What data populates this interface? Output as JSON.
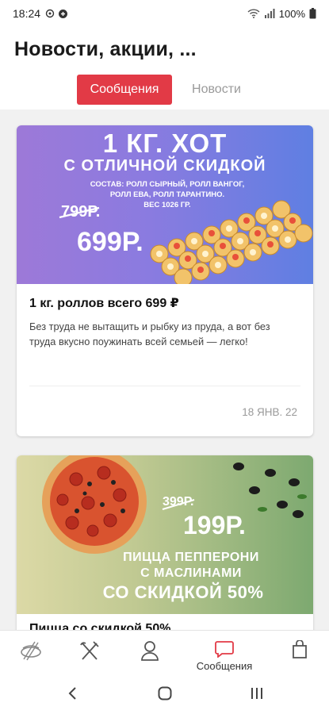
{
  "status_bar": {
    "time": "18:24",
    "battery": "100%"
  },
  "header": {
    "title": "Новости, акции, ..."
  },
  "tabs": [
    {
      "label": "Сообщения",
      "active": true
    },
    {
      "label": "Новости",
      "active": false
    }
  ],
  "posts": [
    {
      "banner": {
        "title": "1 КГ. ХОТ",
        "subtitle": "С ОТЛИЧНОЙ СКИДКОЙ",
        "composition_line1": "СОСТАВ: РОЛЛ СЫРНЫЙ, РОЛЛ ВАНГОГ,",
        "composition_line2": "РОЛЛ ЕВА, РОЛЛ ТАРАНТИНО.",
        "composition_line3": "ВЕС 1026 ГР.",
        "old_price": "799Р.",
        "new_price": "699Р."
      },
      "title": "1 кг. роллов всего 699 ₽",
      "text": "Без труда не вытащить и рыбку из пруда, а вот без труда вкусно поужинать всей семьей — легко!",
      "date": "18 ЯНВ. 22"
    },
    {
      "banner": {
        "old_price": "399Р.",
        "new_price": "199Р.",
        "line1": "ПИЦЦА ПЕППЕРОНИ",
        "line2": "С МАСЛИНАМИ",
        "line3": "СО СКИДКОЙ 50%"
      },
      "title": "Пицца со скидкой 50%"
    }
  ],
  "bottom_nav": [
    {
      "icon": "sushi-icon",
      "label": ""
    },
    {
      "icon": "fork-knife-icon",
      "label": ""
    },
    {
      "icon": "person-icon",
      "label": ""
    },
    {
      "icon": "chat-icon",
      "label": "Сообщения",
      "active": true
    },
    {
      "icon": "bag-icon",
      "label": ""
    }
  ],
  "colors": {
    "accent": "#e23a46",
    "inactive_tab": "#9a9a9a",
    "feed_bg": "#f1f1f1"
  }
}
